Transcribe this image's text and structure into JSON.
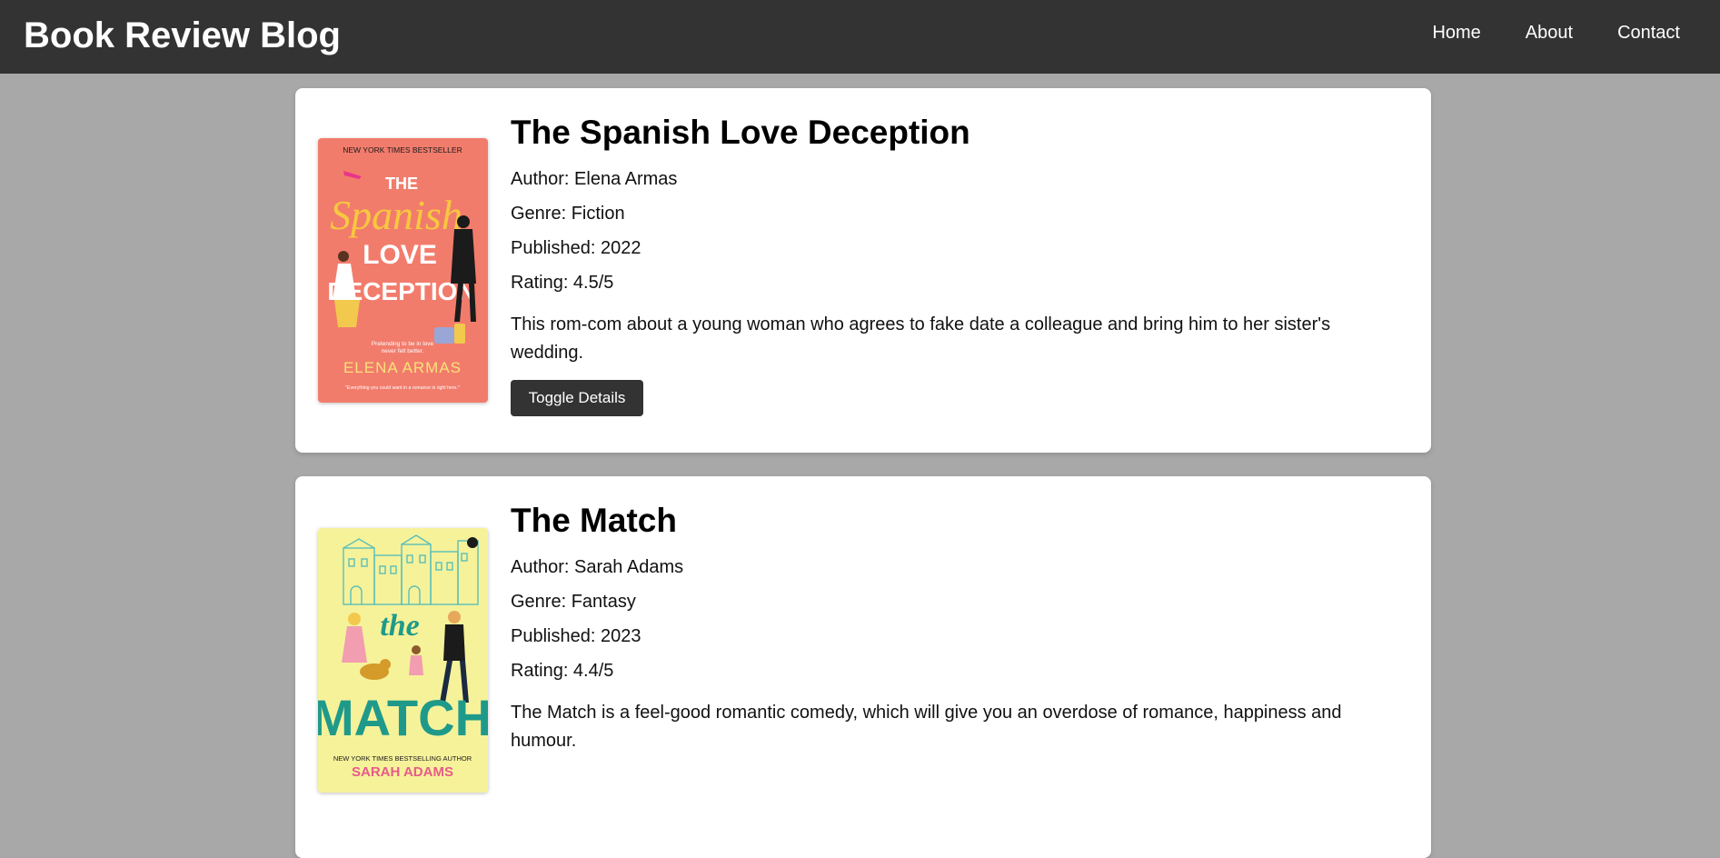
{
  "header": {
    "title": "Book Review Blog",
    "nav": [
      "Home",
      "About",
      "Contact"
    ]
  },
  "books": [
    {
      "title": "The Spanish Love Deception",
      "author": "Author: Elena Armas",
      "genre": "Genre: Fiction",
      "published": "Published: 2022",
      "rating": "Rating: 4.5/5",
      "summary": "This rom-com about a young woman who agrees to fake date a colleague and bring him to her sister's wedding.",
      "button": "Toggle Details",
      "cover": {
        "bg": "#f27c6c",
        "top_line": "NEW YORK TIMES BESTSELLER",
        "title_1": "THE",
        "title_2": "Spanish",
        "title_3": "LOVE",
        "title_4": "DECEPTION",
        "tagline_1": "Pretending to be in love",
        "tagline_2": "never felt better.",
        "author": "ELENA ARMAS",
        "quote": "\"Everything you could want in a romance is right here.\""
      }
    },
    {
      "title": "The Match",
      "author": "Author: Sarah Adams",
      "genre": "Genre: Fantasy",
      "published": "Published: 2023",
      "rating": "Rating: 4.4/5",
      "summary": "The Match is a feel-good romantic comedy, which will give you an overdose of romance, happiness and humour.",
      "cover": {
        "bg": "#f6f29a",
        "title_1": "the",
        "title_2": "MATCH",
        "top_line": "NEW YORK TIMES BESTSELLING AUTHOR",
        "author": "SARAH ADAMS"
      }
    }
  ],
  "colors": {
    "page_bg": "#a9a8a9",
    "header_bg": "#333333",
    "button_bg": "#333333",
    "card_bg": "#ffffff"
  }
}
